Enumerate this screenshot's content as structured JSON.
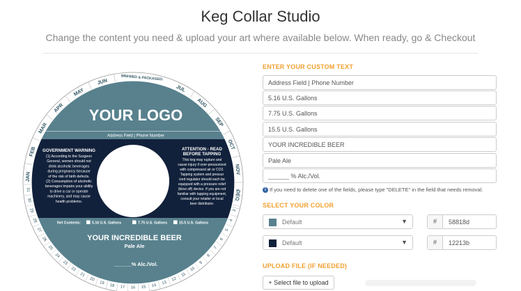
{
  "header": {
    "title": "Keg Collar Studio",
    "subtitle": "Change the content you need & upload your art where available below. When ready, go & Checkout"
  },
  "preview": {
    "logo_text": "YOUR LOGO",
    "address_text": "Address Field | Phone Number",
    "brewed_label": "BREWED & PACKAGED:",
    "months": [
      "JAN",
      "FEB",
      "MAR",
      "APR",
      "MAY",
      "JUN",
      "JUL",
      "AUG",
      "SEP",
      "OCT",
      "NOV",
      "DEC"
    ],
    "days": [
      "1",
      "2",
      "3",
      "4",
      "5",
      "6",
      "7",
      "8",
      "9",
      "10",
      "11",
      "12",
      "13",
      "14",
      "15",
      "16",
      "17",
      "18",
      "19",
      "20",
      "21",
      "22",
      "23",
      "24",
      "25",
      "26",
      "27",
      "28",
      "29",
      "30",
      "31"
    ],
    "warning_left_title": "GOVERNMENT WARNING",
    "warning_left_lines": [
      "(1) According to the Surgeon",
      "General, women should not",
      "drink alcoholic beverages",
      "during pregnancy because",
      "of the risk of birth defects.",
      "(2) Consumption of alcoholic",
      "beverages impairs your ability",
      "to drive a car or operate",
      "machinery, and may cause",
      "health problems."
    ],
    "warning_right_title_1": "ATTENTION - READ",
    "warning_right_title_2": "BEFORE TAPPING",
    "warning_right_lines": [
      "This keg may rupture and",
      "cause injury if over-pressurized",
      "with compressed air or CO2.",
      "Tapping system and pressur",
      "ized regulator should each be",
      "equipped with a pressure relief",
      "(blow off) device. If you are not",
      "familiar with tapping equipment,",
      "consult your retailer or local",
      "beer distributor."
    ],
    "net_contents_label": "Net Contents:",
    "net_options": [
      "5.16 U.S. Gallons",
      "7.75 U.S. Gallons",
      "15.5 U.S. Gallons"
    ],
    "beer_name": "YOUR INCREDIBLE BEER",
    "beer_style": "Pale Ale",
    "abv_text": "______% Alc./Vol."
  },
  "custom_text": {
    "heading": "ENTER YOUR CUSTOM TEXT",
    "fields": [
      "Address Field | Phone Number",
      "5.16 U.S. Gallons",
      "7.75 U.S. Gallons",
      "15.5 U.S. Gallons",
      "YOUR INCREDIBLE BEER",
      "Pale Ale",
      "______ % Alc./Vol."
    ],
    "info_icon": "i",
    "info_text": "If you need to delete one of the fields, please type \"DELETE\" in the field that needs removal."
  },
  "colors": {
    "heading": "SELECT YOUR COLOR",
    "selects": [
      {
        "label": "Default",
        "swatch": "#58818d",
        "hash": "#",
        "hex": "58818d"
      },
      {
        "label": "Default",
        "swatch": "#12213b",
        "hash": "#",
        "hex": "12213b"
      }
    ]
  },
  "upload": {
    "heading": "UPLOAD FILE (IF NEEDED)",
    "button_label": "+ Select file to upload"
  },
  "theme": {
    "accent": "#f0a030",
    "primary": "#58818d",
    "secondary": "#12213b"
  }
}
